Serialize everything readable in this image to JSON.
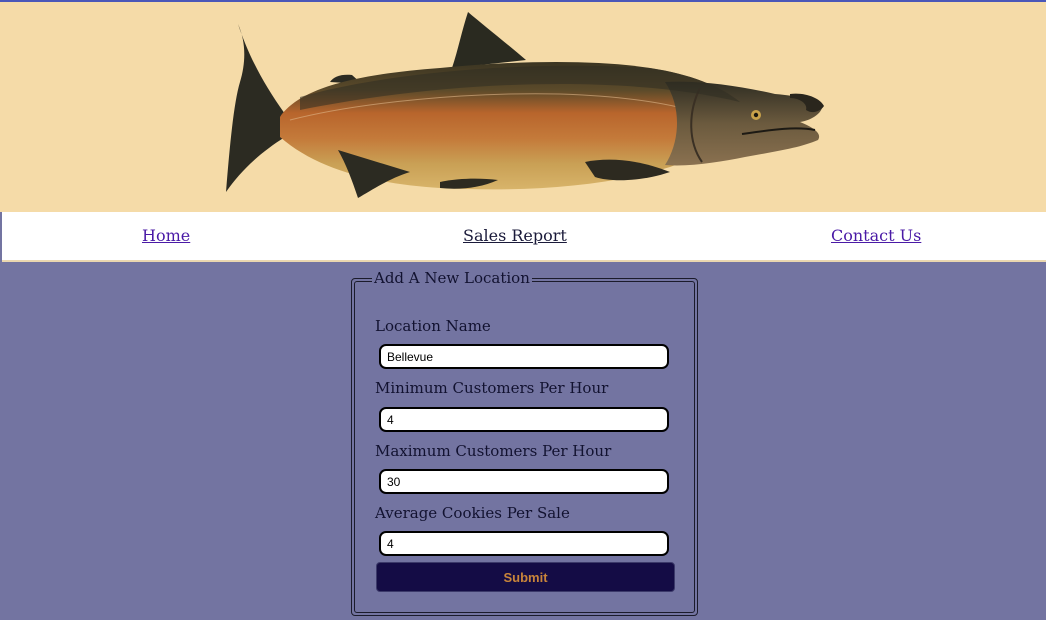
{
  "header": {
    "image": "salmon-illustration"
  },
  "nav": {
    "home": "Home",
    "sales_report": "Sales Report",
    "contact_us": "Contact Us"
  },
  "form": {
    "legend": "Add A New Location",
    "fields": [
      {
        "label": "Location Name",
        "value": "Bellevue"
      },
      {
        "label": "Minimum Customers Per Hour",
        "value": "4"
      },
      {
        "label": "Maximum Customers Per Hour",
        "value": "30"
      },
      {
        "label": "Average Cookies Per Sale",
        "value": "4"
      }
    ],
    "submit_label": "Submit"
  },
  "colors": {
    "page_background": "#7374a1",
    "header_background": "#f5dba8",
    "submit_background": "#140c45",
    "submit_text": "#c8843a"
  }
}
